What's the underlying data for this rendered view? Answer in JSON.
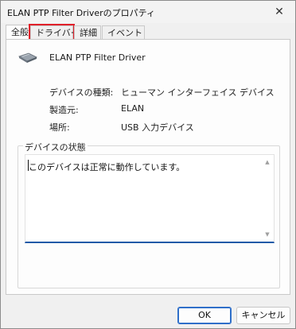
{
  "window": {
    "title": "ELAN PTP Filter Driverのプロパティ",
    "close_glyph": "✕"
  },
  "tabs": [
    {
      "label": "全般",
      "active": true
    },
    {
      "label": "ドライバー",
      "highlighted": true
    },
    {
      "label": "詳細"
    },
    {
      "label": "イベント"
    }
  ],
  "device": {
    "icon": "touchpad-device-icon",
    "name": "ELAN PTP Filter Driver"
  },
  "properties": [
    {
      "label": "デバイスの種類:",
      "value": "ヒューマン インターフェイス デバイス"
    },
    {
      "label": "製造元:",
      "value": "ELAN"
    },
    {
      "label": "場所:",
      "value": "USB 入力デバイス"
    }
  ],
  "status": {
    "group_label": "デバイスの状態",
    "text": "このデバイスは正常に動作しています。"
  },
  "buttons": {
    "ok": "OK",
    "cancel": "キャンセル"
  },
  "colors": {
    "highlight": "#e0202a",
    "accent": "#1f5aa8"
  }
}
